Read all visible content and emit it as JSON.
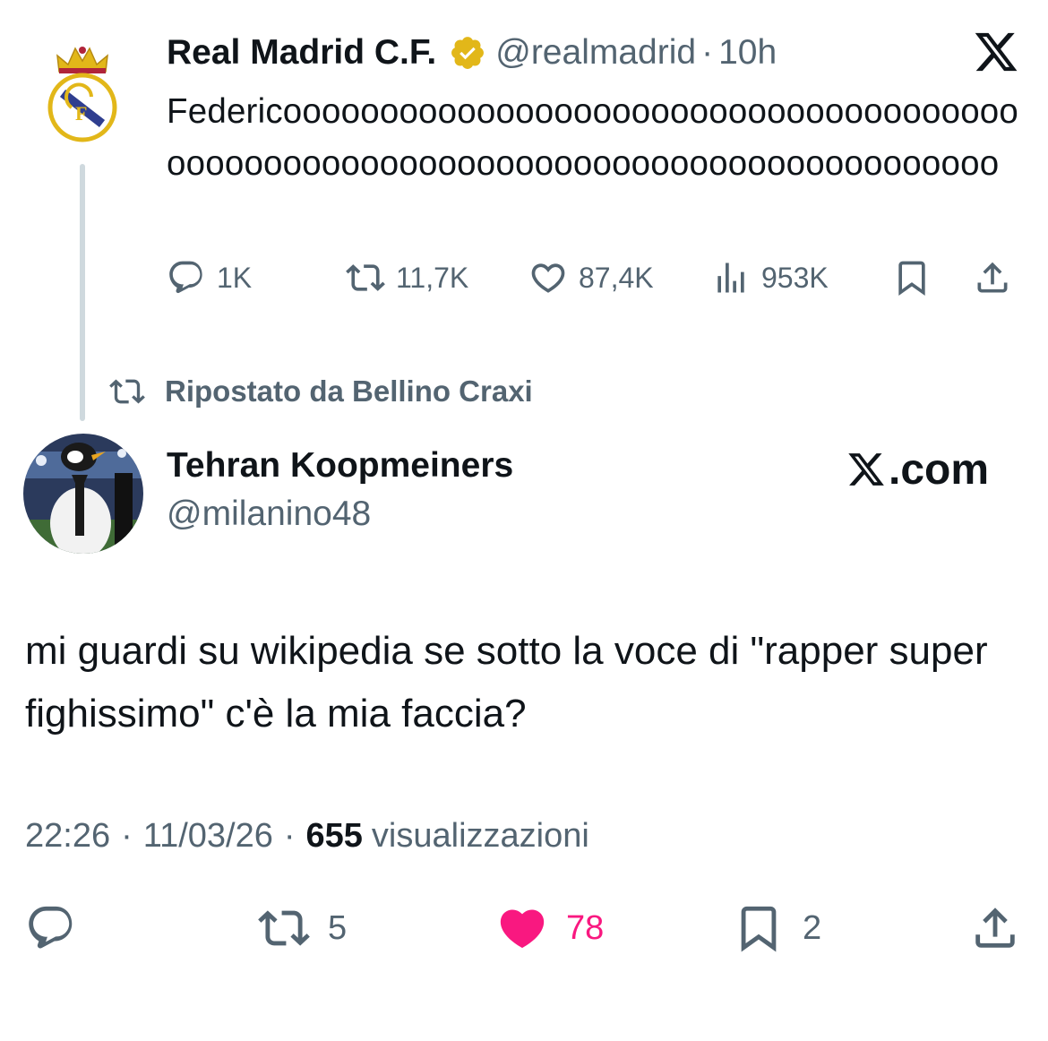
{
  "quoted_tweet": {
    "author_name": "Real Madrid C.F.",
    "handle": "@realmadrid",
    "separator": "·",
    "time": "10h",
    "text": "Federicooooooooooooooooooooooooooooooooooooooooooooooooooooooooooooooooooooooooooooooooo",
    "actions": {
      "replies": "1K",
      "reposts": "11,7K",
      "likes": "87,4K",
      "views": "953K"
    },
    "icons": [
      "verified-gold-badge",
      "x-logo",
      "reply-icon",
      "repost-icon",
      "like-icon",
      "views-icon",
      "bookmark-icon",
      "share-icon"
    ]
  },
  "repost_banner": {
    "text": "Ripostato da Bellino Craxi"
  },
  "main_tweet": {
    "author_name": "Tehran Koopmeiners",
    "handle": "@milanino48",
    "watermark": ".com",
    "text": "mi guardi su wikipedia se sotto la voce di \"rapper super fighissimo\" c'è la mia faccia?",
    "time": "22:26",
    "sep1": "·",
    "date": "11/03/26",
    "sep2": "·",
    "views_count": "655",
    "views_label": "visualizzazioni",
    "actions": {
      "reposts": "5",
      "likes": "78",
      "bookmarks": "2"
    },
    "like_color": "#f91880"
  },
  "colors": {
    "text": "#0f1419",
    "secondary": "#536471",
    "thread_line": "#cfd9de",
    "verified_gold": "#e2b719"
  }
}
